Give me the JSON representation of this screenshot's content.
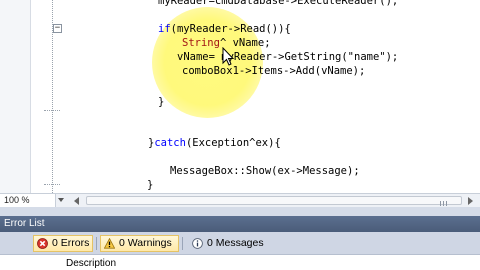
{
  "editor": {
    "code_lines": [
      {
        "tokens": [
          {
            "text": "myReader=cmdDatabase->ExecuteReader();",
            "cls": "mb"
          }
        ]
      },
      {
        "tokens": [
          {
            "text": "if",
            "cls": "kw"
          },
          {
            "text": "(myReader->Read()){",
            "cls": "mb"
          }
        ]
      },
      {
        "tokens": [
          {
            "text": "String",
            "cls": "cl"
          },
          {
            "text": "^ vName;",
            "cls": "mb"
          }
        ]
      },
      {
        "tokens": [
          {
            "text": "vName= myReader->GetString(\"name\");",
            "cls": "mb"
          }
        ]
      },
      {
        "tokens": [
          {
            "text": "comboBox1->Items->Add(vName);",
            "cls": "mb"
          }
        ]
      },
      {
        "tokens": [
          {
            "text": "}",
            "cls": "mb"
          }
        ]
      },
      {
        "tokens": [
          {
            "text": "}",
            "cls": "mb"
          },
          {
            "text": "catch",
            "cls": "kw"
          },
          {
            "text": "(Exception^ex){",
            "cls": "mb"
          }
        ]
      },
      {
        "tokens": [
          {
            "text": "MessageBox::Show(ex->Message);",
            "cls": "mb"
          }
        ]
      },
      {
        "tokens": [
          {
            "text": "}",
            "cls": "mb"
          }
        ]
      }
    ],
    "collapse_symbol": "−",
    "highlight_color": "#fff578",
    "keyword_color": "#0000ff",
    "class_color": "#a31515"
  },
  "statusbar": {
    "zoom": "100 %",
    "grip_icon": "scroll-grip-icon"
  },
  "error_list": {
    "title": "Error List",
    "errors_label": "0 Errors",
    "warnings_label": "0 Warnings",
    "messages_label": "0 Messages",
    "column_description": "Description"
  }
}
